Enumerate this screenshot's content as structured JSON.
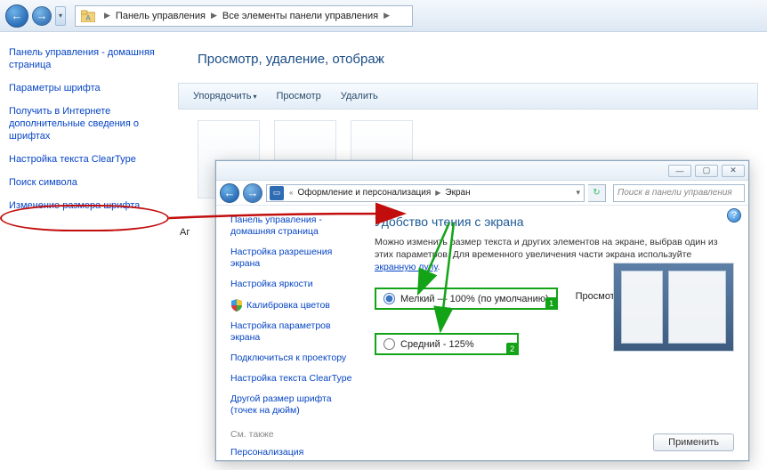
{
  "outer": {
    "breadcrumb": {
      "crumb1": "Панель управления",
      "crumb2": "Все элементы панели управления"
    },
    "heading": "Просмотр, удаление, отображ",
    "cmdbar": {
      "organize": "Упорядочить",
      "view": "Просмотр",
      "delete": "Удалить"
    },
    "ag": "Аг",
    "sidebar": {
      "home": "Панель управления - домашняя страница",
      "font_params": "Параметры шрифта",
      "online_info": "Получить в Интернете дополнительные сведения о шрифтах",
      "cleartype": "Настройка текста ClearType",
      "find_char": "Поиск символа",
      "change_font_size": "Изменение размера шрифта"
    }
  },
  "inner": {
    "breadcrumb": {
      "crumb1": "Оформление и персонализация",
      "crumb2": "Экран"
    },
    "search_placeholder": "Поиск в панели управления",
    "sidebar": {
      "home": "Панель управления - домашняя страница",
      "resolution": "Настройка разрешения экрана",
      "brightness": "Настройка яркости",
      "calibrate": "Калибровка цветов",
      "monitor_params": "Настройка параметров экрана",
      "projector": "Подключиться к проектору",
      "cleartype": "Настройка текста ClearType",
      "other_dpi": "Другой размер шрифта (точек на дюйм)",
      "see_also_h": "См. также",
      "personalize": "Персонализация"
    },
    "heading": "Удобство чтения с экрана",
    "desc_pre": "Можно изменить размер текста и других элементов на экране, выбрав один из этих параметров. Для временного увеличения части экрана используйте ",
    "desc_link": "экранную лупу",
    "options": {
      "small": "Мелкий — 100% (по умолчанию)",
      "medium": "Средний - 125%",
      "preview": "Просмотр"
    },
    "badges": {
      "one": "1",
      "two": "2"
    },
    "apply": "Применить"
  }
}
